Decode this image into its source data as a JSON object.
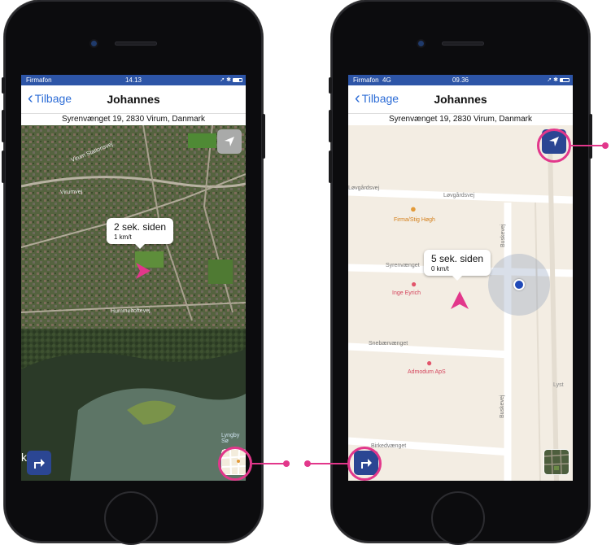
{
  "phones": [
    {
      "status": {
        "carrier": "Firmafon",
        "time": "14.13"
      },
      "nav": {
        "back_label": "Tilbage",
        "title": "Johannes"
      },
      "address": "Syrenvænget 19, 2830 Virum, Danmark",
      "map_style": "satellite",
      "callout": {
        "time_ago": "2 sek. siden",
        "speed": "1 km/t"
      },
      "map_labels": [
        "Virum Stationsvej",
        "Virumvej",
        "Hummeltoftevej",
        "ksdal",
        "Lyngby Sø"
      ],
      "colors": {
        "marker": "#e2378b",
        "button": "#2b4693"
      }
    },
    {
      "status": {
        "carrier": "Firmafon",
        "network": "4G",
        "time": "09.36"
      },
      "nav": {
        "back_label": "Tilbage",
        "title": "Johannes"
      },
      "address": "Syrenvænget 19, 2830 Virum, Danmark",
      "map_style": "standard",
      "callout": {
        "time_ago": "5 sek. siden",
        "speed": "0 km/t"
      },
      "pois": [
        "Firma/Stig Høgh",
        "Inge Eyrich",
        "Admodum ApS"
      ],
      "streets": [
        "Løvgårdsvej",
        "Syrenvænget",
        "Snebærvænget",
        "Buskevej",
        "Birkedvænget",
        "Lyst"
      ],
      "colors": {
        "marker": "#e2378b",
        "button": "#2b4693",
        "location_dot": "#1f49b8"
      }
    }
  ],
  "icons": {
    "locate": "location-arrow-icon",
    "directions": "directions-turn-icon",
    "map_type": "map-type-thumbnail-icon"
  }
}
